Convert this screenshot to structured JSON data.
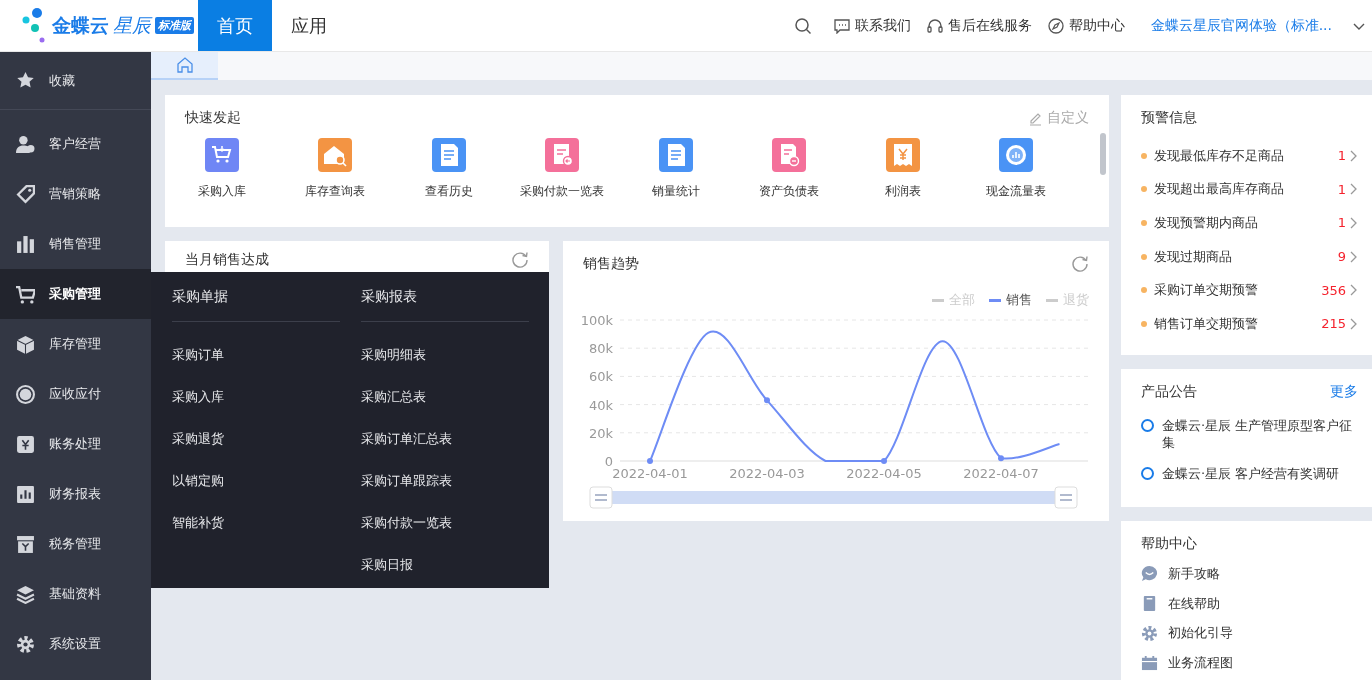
{
  "header": {
    "logo": {
      "brand": "金蝶云",
      "product": "星辰",
      "edition": "标准版"
    },
    "nav": [
      {
        "label": "首页",
        "selected": true
      },
      {
        "label": "应用",
        "selected": false
      }
    ],
    "links": [
      "联系我们",
      "售后在线服务",
      "帮助中心"
    ],
    "account": "金蝶云星辰官网体验（标准..."
  },
  "sidebar": {
    "items": [
      {
        "label": "收藏",
        "selected": false
      },
      {
        "label": "客户经营",
        "selected": false
      },
      {
        "label": "营销策略",
        "selected": false
      },
      {
        "label": "销售管理",
        "selected": false
      },
      {
        "label": "采购管理",
        "selected": true
      },
      {
        "label": "库存管理",
        "selected": false
      },
      {
        "label": "应收应付",
        "selected": false
      },
      {
        "label": "账务处理",
        "selected": false
      },
      {
        "label": "财务报表",
        "selected": false
      },
      {
        "label": "税务管理",
        "selected": false
      },
      {
        "label": "基础资料",
        "selected": false
      },
      {
        "label": "系统设置",
        "selected": false
      }
    ]
  },
  "flyout": {
    "columns": [
      {
        "heading": "采购单据",
        "items": [
          "采购订单",
          "采购入库",
          "采购退货",
          "以销定购",
          "智能补货"
        ]
      },
      {
        "heading": "采购报表",
        "items": [
          "采购明细表",
          "采购汇总表",
          "采购订单汇总表",
          "采购订单跟踪表",
          "采购付款一览表",
          "采购日报"
        ]
      }
    ]
  },
  "quick_launch": {
    "title": "快速发起",
    "action": "自定义",
    "items": [
      {
        "label": "采购入库",
        "color": "#6f86f5"
      },
      {
        "label": "库存查询表",
        "color": "#f39443"
      },
      {
        "label": "查看历史",
        "color": "#4a93f5"
      },
      {
        "label": "采购付款一览表",
        "color": "#f4709a"
      },
      {
        "label": "销量统计",
        "color": "#4a93f5"
      },
      {
        "label": "资产负债表",
        "color": "#f4709a"
      },
      {
        "label": "利润表",
        "color": "#f39443"
      },
      {
        "label": "现金流量表",
        "color": "#4a93f5"
      }
    ]
  },
  "monthly_sales": {
    "title": "当月销售达成"
  },
  "sales_trend": {
    "title": "销售趋势",
    "legend": [
      {
        "label": "全部",
        "selected": false
      },
      {
        "label": "销售",
        "selected": true
      },
      {
        "label": "退货",
        "selected": false
      }
    ],
    "chart_data": {
      "type": "line",
      "grid": true,
      "categories": [
        "2022-04-01",
        null,
        "2022-04-03",
        null,
        "2022-04-05",
        null,
        "2022-04-07",
        null
      ],
      "series": [
        {
          "color": "#6e8cf5",
          "values": [
            0,
            91000,
            43000,
            0,
            0,
            85000,
            2000,
            12000
          ]
        }
      ],
      "ylim": [
        0,
        100000
      ],
      "yticks": [
        {
          "value": 0,
          "label": "0"
        },
        {
          "value": 20000,
          "label": "20k"
        },
        {
          "value": 40000,
          "label": "40k"
        },
        {
          "value": 60000,
          "label": "60k"
        },
        {
          "value": 80000,
          "label": "80k"
        },
        {
          "value": 100000,
          "label": "100k"
        }
      ]
    }
  },
  "alerts": {
    "title": "预警信息",
    "items": [
      {
        "text": "发现最低库存不足商品",
        "count": "1"
      },
      {
        "text": "发现超出最高库存商品",
        "count": "1"
      },
      {
        "text": "发现预警期内商品",
        "count": "1"
      },
      {
        "text": "发现过期商品",
        "count": "9"
      },
      {
        "text": "采购订单交期预警",
        "count": "356"
      },
      {
        "text": "销售订单交期预警",
        "count": "215"
      }
    ]
  },
  "announcements": {
    "title": "产品公告",
    "more": "更多",
    "items": [
      "金蝶云·星辰 生产管理原型客户征集",
      "金蝶云·星辰 客户经营有奖调研"
    ]
  },
  "help": {
    "title": "帮助中心",
    "items": [
      "新手攻略",
      "在线帮助",
      "初始化引导",
      "业务流程图"
    ]
  }
}
